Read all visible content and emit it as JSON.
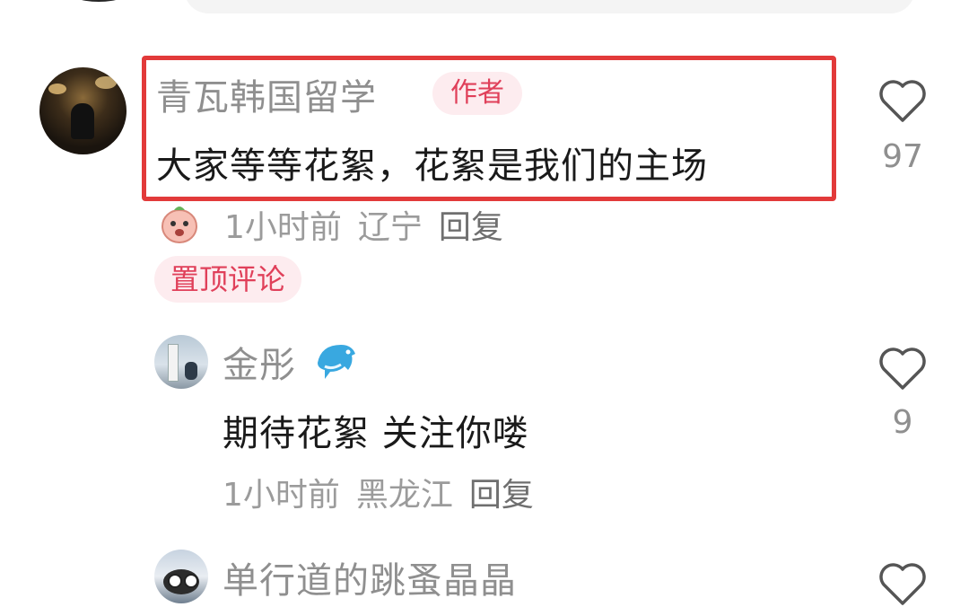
{
  "comments": [
    {
      "username": "青瓦韩国留学",
      "author_tag": "作者",
      "text": "大家等等花絮，花絮是我们的主场",
      "time": "1小时前",
      "location": "辽宁",
      "reply_label": "回复",
      "pinned_tag": "置顶评论",
      "likes": "97"
    },
    {
      "username": "金彤",
      "text": "期待花絮 关注你喽",
      "time": "1小时前",
      "location": "黑龙江",
      "reply_label": "回复",
      "likes": "9"
    },
    {
      "username": "单行道的跳蚤晶晶"
    }
  ],
  "colors": {
    "highlight_border": "#e23a3a",
    "tag_bg": "#fdecef",
    "tag_text": "#e0405a"
  }
}
